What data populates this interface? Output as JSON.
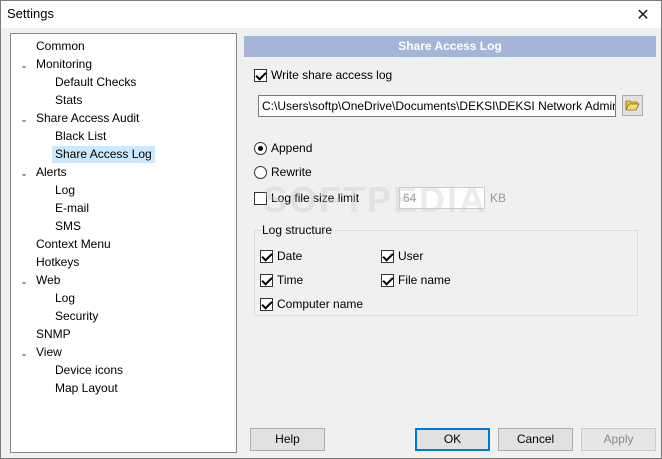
{
  "window": {
    "title": "Settings"
  },
  "icons": {
    "close": "close-icon",
    "browse": "folder-open-icon",
    "chevron": "chevron-down-icon"
  },
  "tree": {
    "items": [
      {
        "label": "Common",
        "level": 0,
        "expandable": false
      },
      {
        "label": "Monitoring",
        "level": 0,
        "expandable": true
      },
      {
        "label": "Default Checks",
        "level": 1
      },
      {
        "label": "Stats",
        "level": 1
      },
      {
        "label": "Share Access Audit",
        "level": 0,
        "expandable": true
      },
      {
        "label": "Black List",
        "level": 1
      },
      {
        "label": "Share Access Log",
        "level": 1,
        "selected": true
      },
      {
        "label": "Alerts",
        "level": 0,
        "expandable": true
      },
      {
        "label": "Log",
        "level": 1
      },
      {
        "label": "E-mail",
        "level": 1
      },
      {
        "label": "SMS",
        "level": 1
      },
      {
        "label": "Context Menu",
        "level": 0
      },
      {
        "label": "Hotkeys",
        "level": 0
      },
      {
        "label": "Web",
        "level": 0,
        "expandable": true
      },
      {
        "label": "Log",
        "level": 1
      },
      {
        "label": "Security",
        "level": 1
      },
      {
        "label": "SNMP",
        "level": 0
      },
      {
        "label": "View",
        "level": 0,
        "expandable": true
      },
      {
        "label": "Device icons",
        "level": 1
      },
      {
        "label": "Map Layout",
        "level": 1
      }
    ]
  },
  "panel": {
    "header": "Share Access Log",
    "write_log": {
      "label": "Write share access log",
      "checked": true
    },
    "path": "C:\\Users\\softp\\OneDrive\\Documents\\DEKSI\\DEKSI Network Admin",
    "mode": {
      "append": {
        "label": "Append",
        "selected": true
      },
      "rewrite": {
        "label": "Rewrite",
        "selected": false
      }
    },
    "size_limit": {
      "label": "Log file size limit",
      "checked": false,
      "value": "64",
      "unit": "KB"
    },
    "structure": {
      "title": "Log structure",
      "date": {
        "label": "Date",
        "checked": true
      },
      "user": {
        "label": "User",
        "checked": true
      },
      "time": {
        "label": "Time",
        "checked": true
      },
      "file_name": {
        "label": "File name",
        "checked": true
      },
      "computer_name": {
        "label": "Computer name",
        "checked": true
      }
    }
  },
  "buttons": {
    "help": "Help",
    "ok": "OK",
    "cancel": "Cancel",
    "apply": "Apply",
    "apply_enabled": false
  },
  "watermark": "SOFTPEDIA"
}
